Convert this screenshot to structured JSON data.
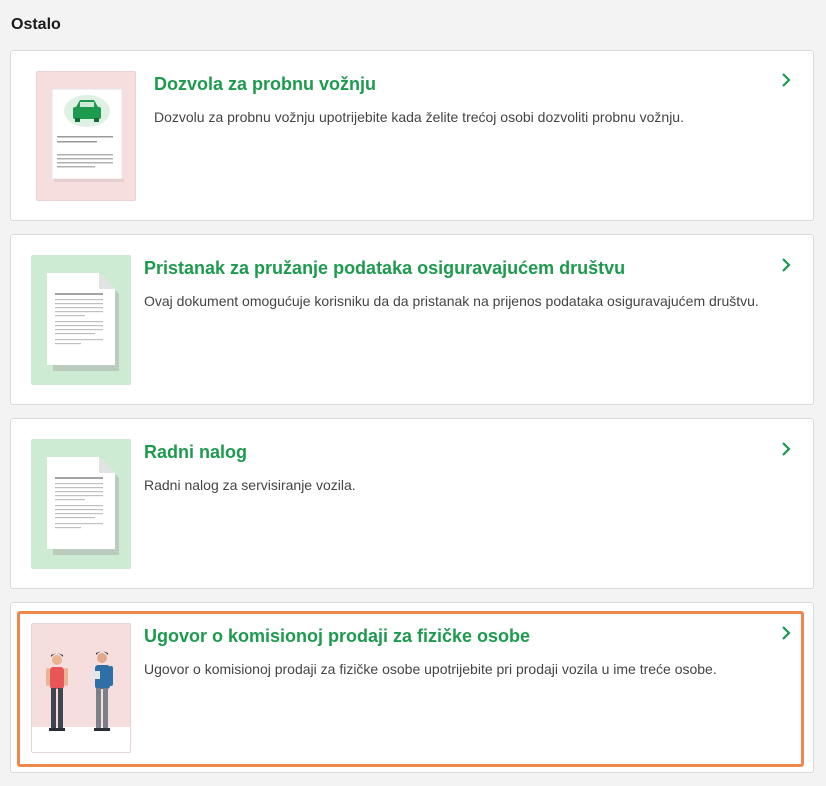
{
  "section": {
    "title": "Ostalo"
  },
  "cards": [
    {
      "title": "Dozvola za probnu vožnju",
      "description": "Dozvolu za probnu vožnju upotrijebite kada želite trećoj osobi dozvoliti probnu vožnju.",
      "thumb_icon": "car-document-icon"
    },
    {
      "title": "Pristanak za pružanje podataka osiguravajućem društvu",
      "description": "Ovaj dokument omogućuje korisniku da da pristanak na prijenos podataka osiguravajućem društvu.",
      "thumb_icon": "document-icon"
    },
    {
      "title": "Radni nalog",
      "description": "Radni nalog za servisiranje vozila.",
      "thumb_icon": "document-icon"
    },
    {
      "title": "Ugovor o komisionoj prodaji za fizičke osobe",
      "description": "Ugovor o komisionoj prodaji za fizičke osobe upotrijebite pri prodaji vozila u ime treće osobe.",
      "thumb_icon": "people-icon",
      "highlighted": true
    }
  ],
  "colors": {
    "accent": "#1e9a4f",
    "highlight": "#f2874a",
    "thumb_pink": "#f6dede",
    "thumb_green": "#cdebd3"
  }
}
